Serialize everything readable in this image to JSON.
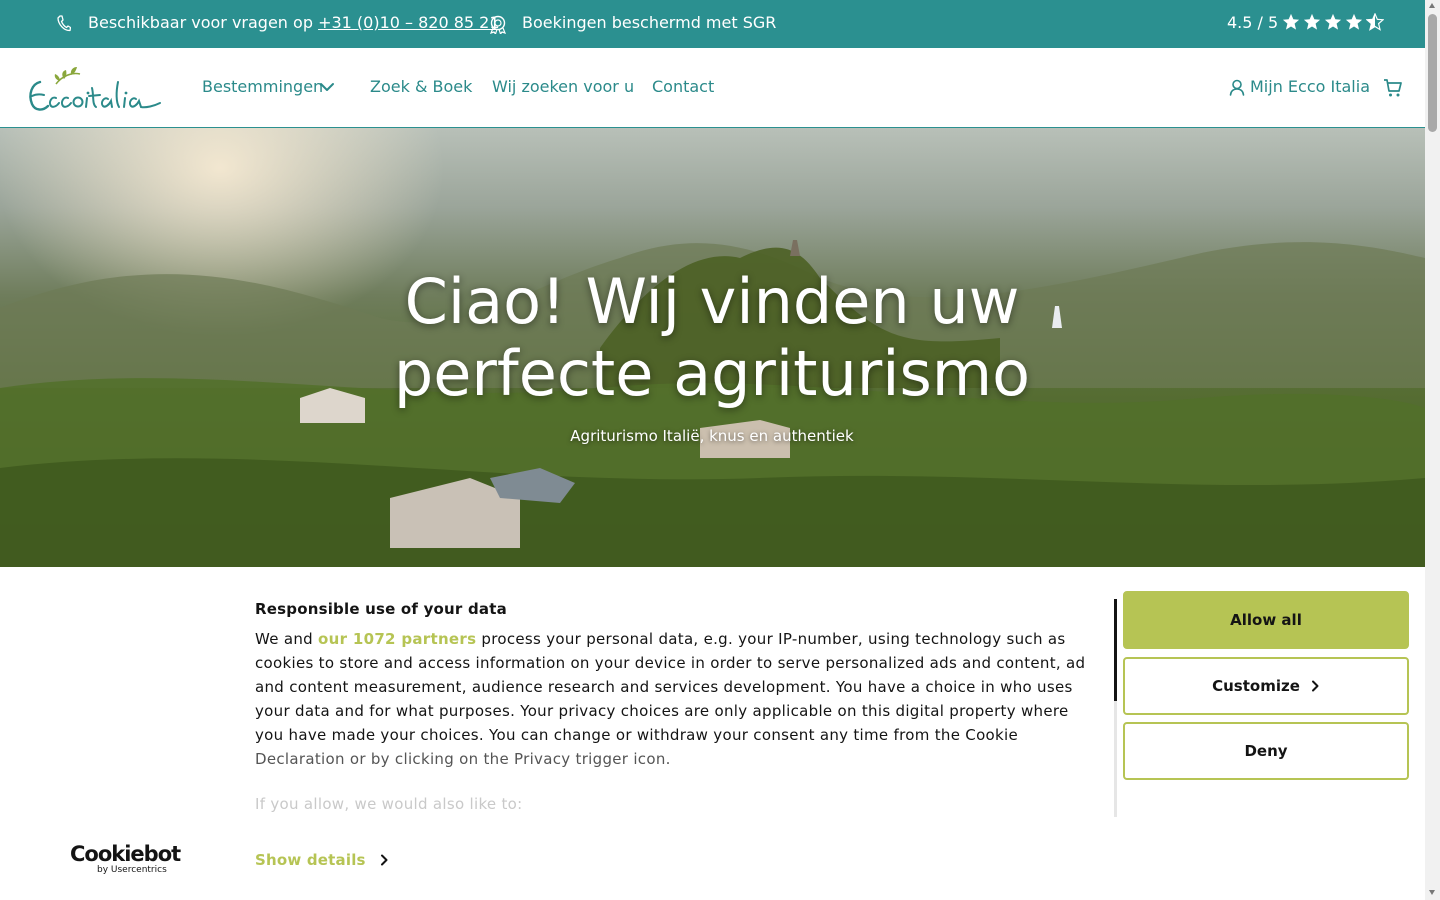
{
  "topbar": {
    "phone_prefix": "Beschikbaar voor vragen op ",
    "phone_number": "+31 (0)10 – 820 85 21",
    "sgr_text": "Boekingen beschermd met SGR",
    "rating": "4.5 / 5",
    "stars": 4.5
  },
  "header": {
    "logo_text": "Ecco Italia",
    "nav": [
      "Bestemmingen",
      "Zoek & Boek",
      "Wij zoeken voor u",
      "Contact"
    ],
    "account_label": "Mijn Ecco Italia"
  },
  "hero": {
    "title_line1": "Ciao! Wij vinden uw",
    "title_line2": "perfecte agriturismo",
    "subtitle": "Agriturismo Italië, knus en authentiek"
  },
  "cookie": {
    "title": "Responsible use of your data",
    "text_we": "We and ",
    "partners_link": "our 1072 partners",
    "text_body": " process your personal data, e.g. your IP-number, using technology such as cookies to store and access information on your device in order to serve personalized ads and content, ad and content measurement, audience research and services development. You have a choice in who uses your data and for what purposes. Your privacy choices are only applicable on this digital property where you have made your choices. You can change or withdraw your consent any time from the Cookie ",
    "text_faded": "Declaration or by clicking on the Privacy trigger icon.",
    "more_text": "If you allow, we would also like to:",
    "allow_all": "Allow all",
    "customize": "Customize",
    "deny": "Deny",
    "show_details": "Show details",
    "brand": "Cookiebot",
    "brand_by": "by Usercentrics"
  },
  "colors": {
    "teal": "#2b9090",
    "accent_green": "#b6c454"
  }
}
